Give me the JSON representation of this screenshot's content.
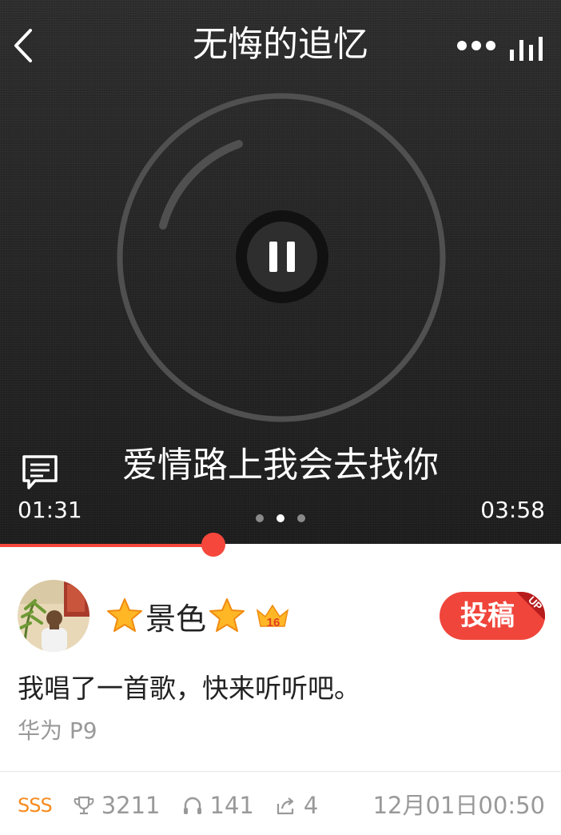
{
  "player": {
    "song_title": "无悔的追忆",
    "lyric": "爱情路上我会去找你",
    "current_time": "01:31",
    "total_time": "03:58",
    "progress_fraction": 0.38,
    "page_dots": 3,
    "active_dot": 1
  },
  "post": {
    "username": "景色",
    "user_level": "16",
    "submit_label": "投稿",
    "ribbon_label": "UP",
    "content": "我唱了一首歌，快来听听吧。",
    "device": "华为 P9"
  },
  "stats": {
    "level_badge": "SSS",
    "trophies": "3211",
    "listens": "141",
    "shares": "4",
    "timestamp": "12月01日00:50"
  },
  "colors": {
    "accent": "#f0453b",
    "player_bg": "#222222",
    "badge_orange": "#f78b1f",
    "muted_text": "#999999"
  }
}
